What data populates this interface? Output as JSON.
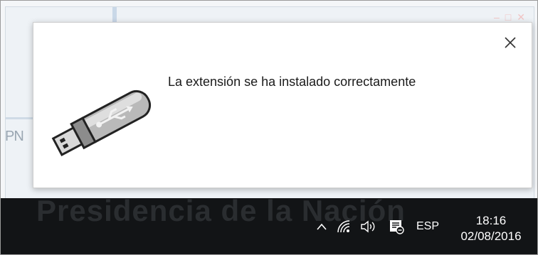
{
  "background": {
    "partial_text": "PN",
    "wallpaper_text": "Presidencia de la Nación"
  },
  "toast": {
    "message": "La extensión se ha instalado correctamente",
    "icon": "usb-drive-icon",
    "close_icon": "close-icon"
  },
  "taskbar": {
    "tray_icons": [
      "chevron-up-icon",
      "wifi-icon",
      "volume-icon",
      "notifications-icon"
    ],
    "language": "ESP",
    "time": "18:16",
    "date": "02/08/2016"
  },
  "colors": {
    "taskbar": "#121416",
    "toast_bg": "#ffffff",
    "text": "#1a1a1a"
  }
}
